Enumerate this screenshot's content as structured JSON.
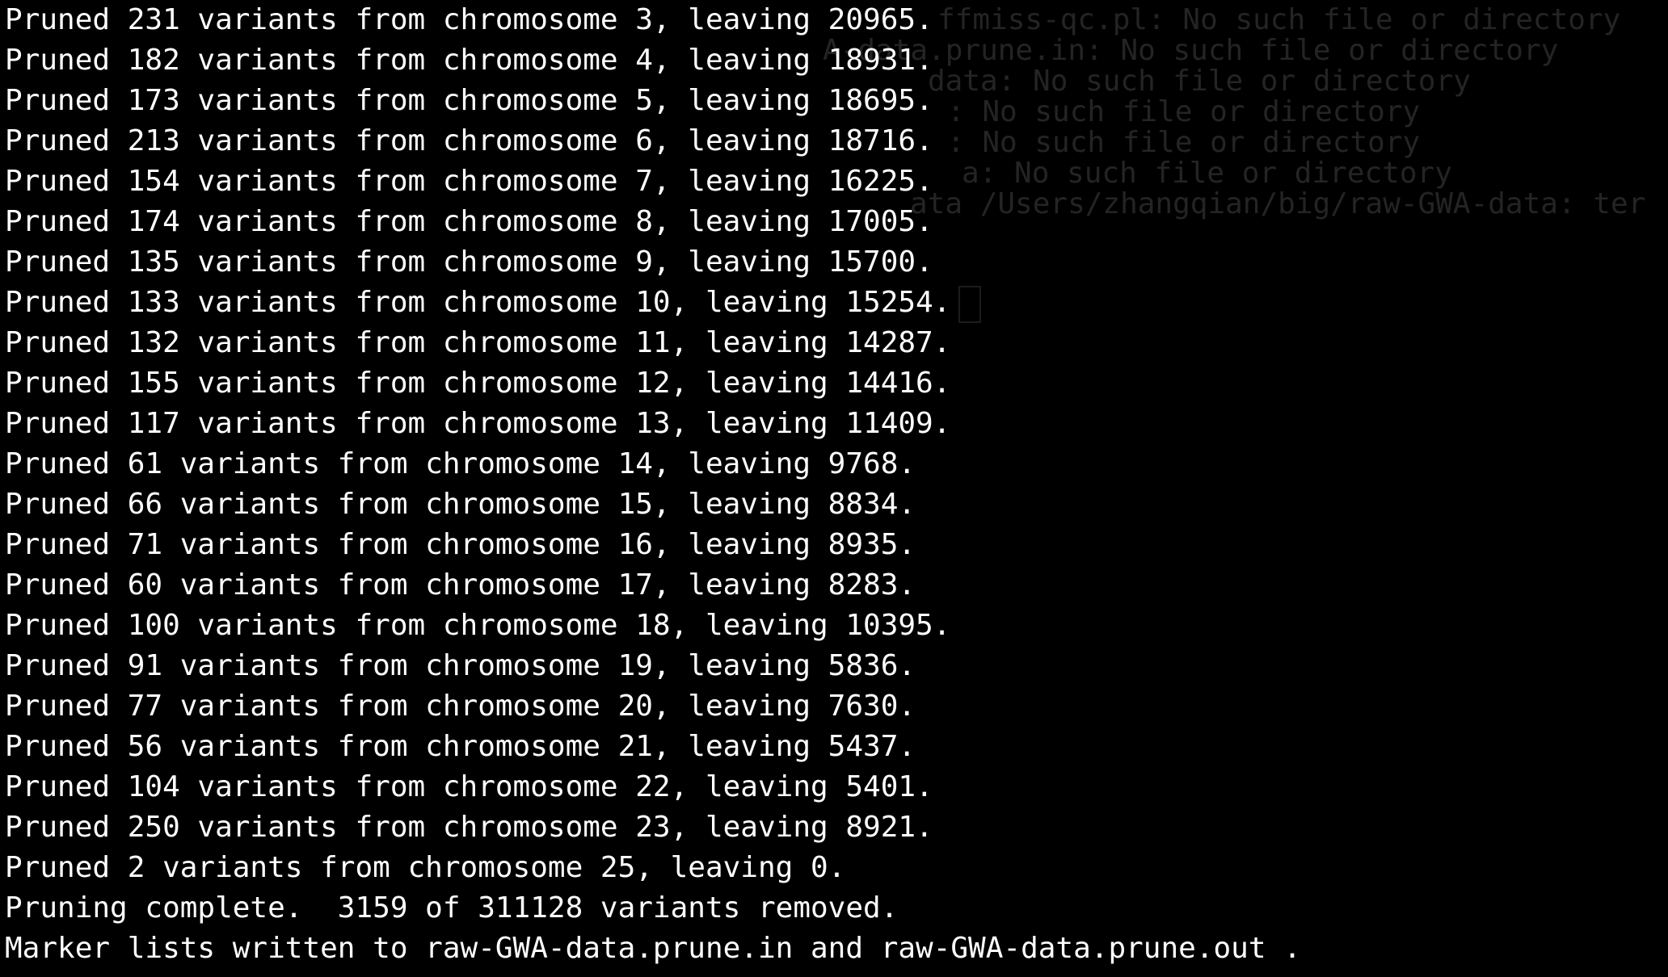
{
  "terminal": {
    "background": "#000000",
    "foreground": "#ffffff",
    "output_lines": [
      "Pruned 231 variants from chromosome 3, leaving 20965.",
      "Pruned 182 variants from chromosome 4, leaving 18931.",
      "Pruned 173 variants from chromosome 5, leaving 18695.",
      "Pruned 213 variants from chromosome 6, leaving 18716.",
      "Pruned 154 variants from chromosome 7, leaving 16225.",
      "Pruned 174 variants from chromosome 8, leaving 17005.",
      "Pruned 135 variants from chromosome 9, leaving 15700.",
      "Pruned 133 variants from chromosome 10, leaving 15254.",
      "Pruned 132 variants from chromosome 11, leaving 14287.",
      "Pruned 155 variants from chromosome 12, leaving 14416.",
      "Pruned 117 variants from chromosome 13, leaving 11409.",
      "Pruned 61 variants from chromosome 14, leaving 9768.",
      "Pruned 66 variants from chromosome 15, leaving 8834.",
      "Pruned 71 variants from chromosome 16, leaving 8935.",
      "Pruned 60 variants from chromosome 17, leaving 8283.",
      "Pruned 100 variants from chromosome 18, leaving 10395.",
      "Pruned 91 variants from chromosome 19, leaving 5836.",
      "Pruned 77 variants from chromosome 20, leaving 7630.",
      "Pruned 56 variants from chromosome 21, leaving 5437.",
      "Pruned 104 variants from chromosome 22, leaving 5401.",
      "Pruned 250 variants from chromosome 23, leaving 8921.",
      "Pruned 2 variants from chromosome 25, leaving 0.",
      "Pruning complete.  3159 of 311128 variants removed.",
      "Marker lists written to raw-GWA-data.prune.in and raw-GWA-data.prune.out ."
    ],
    "background_window_text": [
      "ffmiss-qc.pl: No such file or directory",
      "A-data.prune.in: No such file or directory",
      "data: No such file or directory",
      ": No such file or directory",
      ": No such file or directory",
      "a: No such file or directory",
      "ata /Users/zhangqian/big/raw-GWA-data: ter"
    ]
  }
}
